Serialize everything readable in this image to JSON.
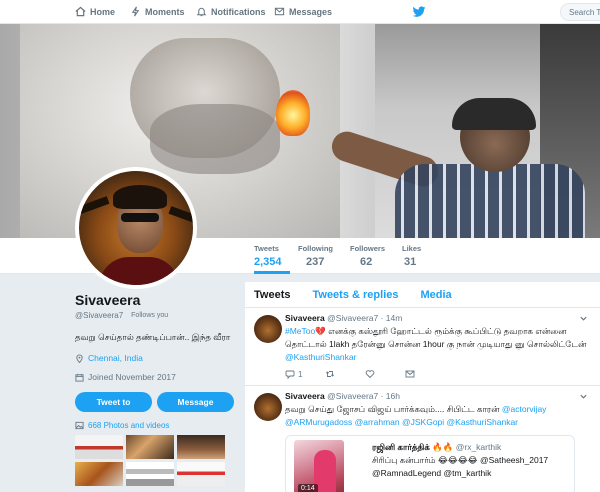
{
  "nav": {
    "home": "Home",
    "moments": "Moments",
    "notifications": "Notifications",
    "messages": "Messages",
    "search_placeholder": "Search Tw"
  },
  "profile": {
    "name": "Sivaveera",
    "handle": "@Sivaveera7",
    "follows_you": "Follows you",
    "bio": "தவறு செய்தால் தண்டிப்பான்.. இந்த வீரா",
    "location": "Chennai, India",
    "joined": "Joined November 2017",
    "tweet_to": "Tweet to",
    "message": "Message",
    "photos_link": "668 Photos and videos"
  },
  "stats": [
    {
      "label": "Tweets",
      "value": "2,354"
    },
    {
      "label": "Following",
      "value": "237"
    },
    {
      "label": "Followers",
      "value": "62"
    },
    {
      "label": "Likes",
      "value": "31"
    }
  ],
  "tabs": [
    "Tweets",
    "Tweets & replies",
    "Media"
  ],
  "tweets": [
    {
      "name": "Sivaveera",
      "handle": "@Sivaveera7",
      "time": "· 14m",
      "hashtag": "#MeToo",
      "line1": " எனக்கு கஸ்தூரி ஹோட்டல் ரூம்க்கு கூப்பிட்டு தவறாக என்னை",
      "line2": "தொட்டால் 1lakh தரேன்னு சொன்ன 1hour கு நான் முடியாது னு சொல்லிட்டேன்",
      "mention": "@KasthuriShankar",
      "reply_count": "1"
    },
    {
      "name": "Sivaveera",
      "handle": "@Sivaveera7",
      "time": "· 16h",
      "text1": "தவறு செய்து ஜோசப் விஜய் பார்க்கவும்.... சிபிட்ட காரன் ",
      "mention1": "@actorvijay",
      "mention2": "@ARMurugadoss",
      "mention3": "@arrahman",
      "mention4": "@JSKGopi",
      "mention5": "@KasthuriShankar",
      "quote_name": "ரஜினி கார்த்திக் 🔥🔥",
      "quote_handle": "@rx_karthik",
      "quote_line2a": "சிரிப்பு கன்பார்ம் 😂😂😂😂 ",
      "quote_line2b": "@Satheesh_2017",
      "quote_line3a": "@RamnadLegend",
      "quote_line3b": " @tm_karthik",
      "video_time": "0:14"
    }
  ]
}
